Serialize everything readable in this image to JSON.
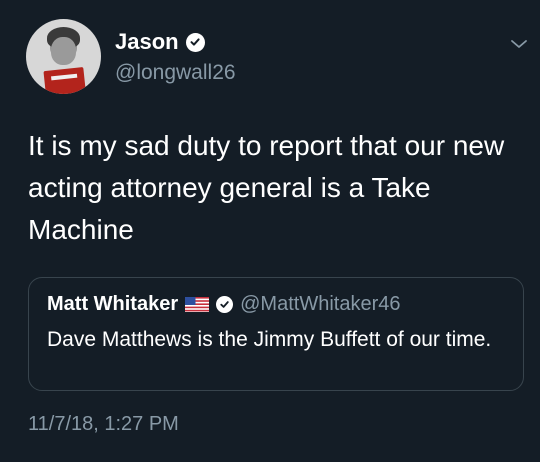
{
  "author": {
    "display_name": "Jason",
    "handle": "@longwall26",
    "verified_icon": "verified-badge-icon"
  },
  "tweet": {
    "text": "It is my sad duty to report that our new acting attorney general is a Take Machine",
    "timestamp": "11/7/18, 1:27 PM"
  },
  "quoted_tweet": {
    "display_name": "Matt Whitaker",
    "handle": "@MattWhitaker46",
    "flag_icon": "us-flag-icon",
    "text": "Dave Matthews is the Jimmy Buffett of our time."
  },
  "menu": {
    "icon": "chevron-down-icon"
  },
  "colors": {
    "background": "#141d26",
    "primary_text": "#ffffff",
    "secondary_text": "#8899a6",
    "border": "#38444d"
  }
}
